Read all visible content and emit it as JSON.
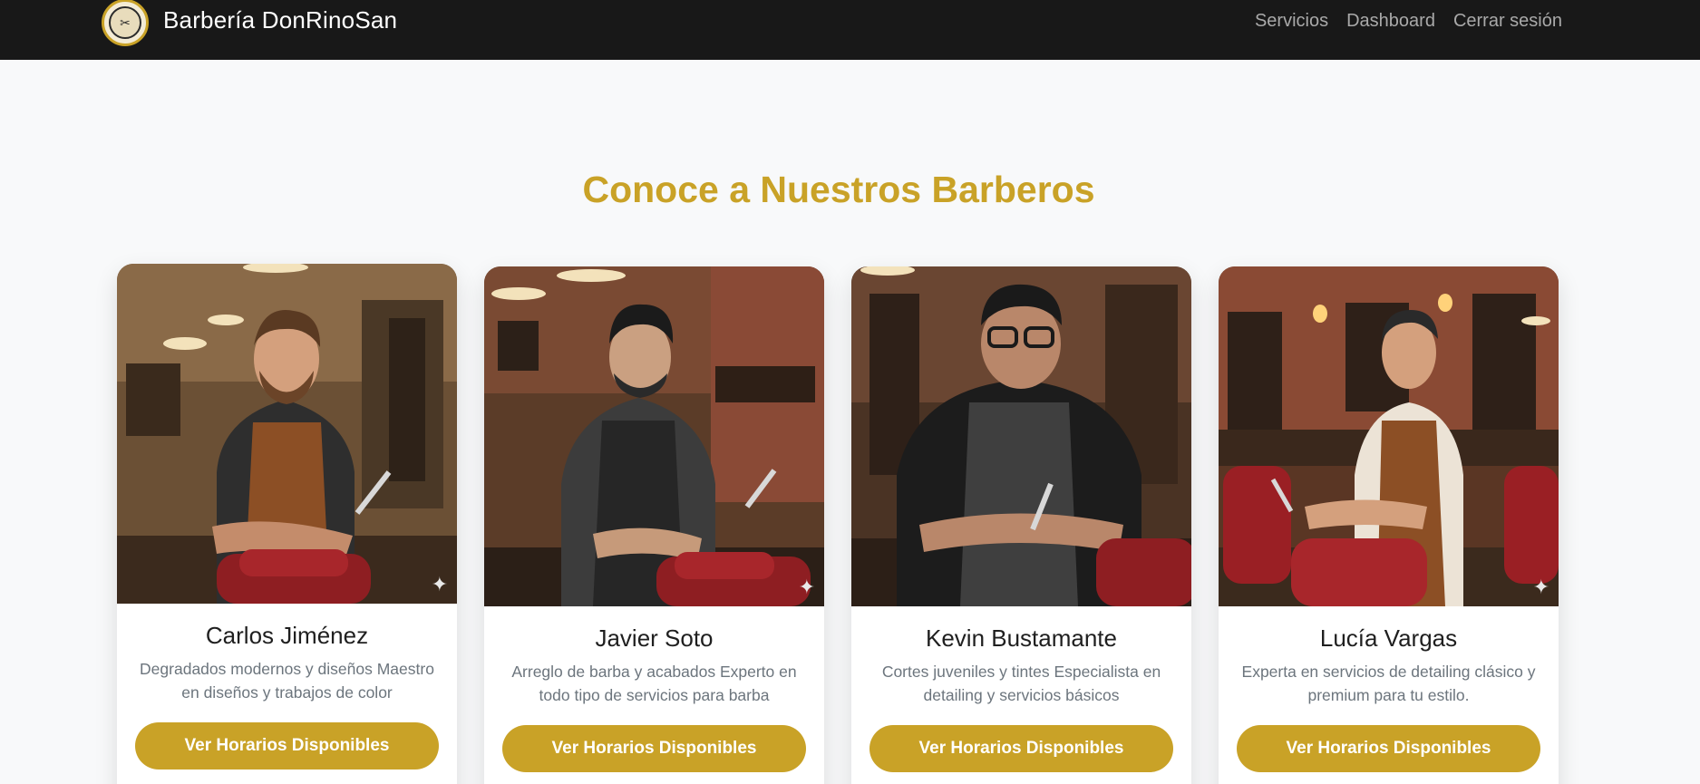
{
  "navbar": {
    "brand_name": "Barbería DonRinoSan",
    "links": [
      "Servicios",
      "Dashboard",
      "Cerrar sesión"
    ]
  },
  "section": {
    "title": "Conoce a Nuestros Barberos"
  },
  "barbers": [
    {
      "name": "Carlos Jiménez",
      "description": "Degradados modernos y diseños Maestro en diseños y trabajos de color",
      "button_label": "Ver Horarios Disponibles"
    },
    {
      "name": "Javier Soto",
      "description": "Arreglo de barba y acabados Experto en todo tipo de servicios para barba",
      "button_label": "Ver Horarios Disponibles"
    },
    {
      "name": "Kevin Bustamante",
      "description": "Cortes juveniles y tintes Especialista en detailing y servicios básicos",
      "button_label": "Ver Horarios Disponibles"
    },
    {
      "name": "Lucía Vargas",
      "description": "Experta en servicios de detailing clásico y premium para tu estilo.",
      "button_label": "Ver Horarios Disponibles"
    }
  ],
  "colors": {
    "navbar_bg": "#181818",
    "accent_gold": "#c9a227",
    "page_bg": "#f8f9fa",
    "muted_text": "#6c757d"
  }
}
